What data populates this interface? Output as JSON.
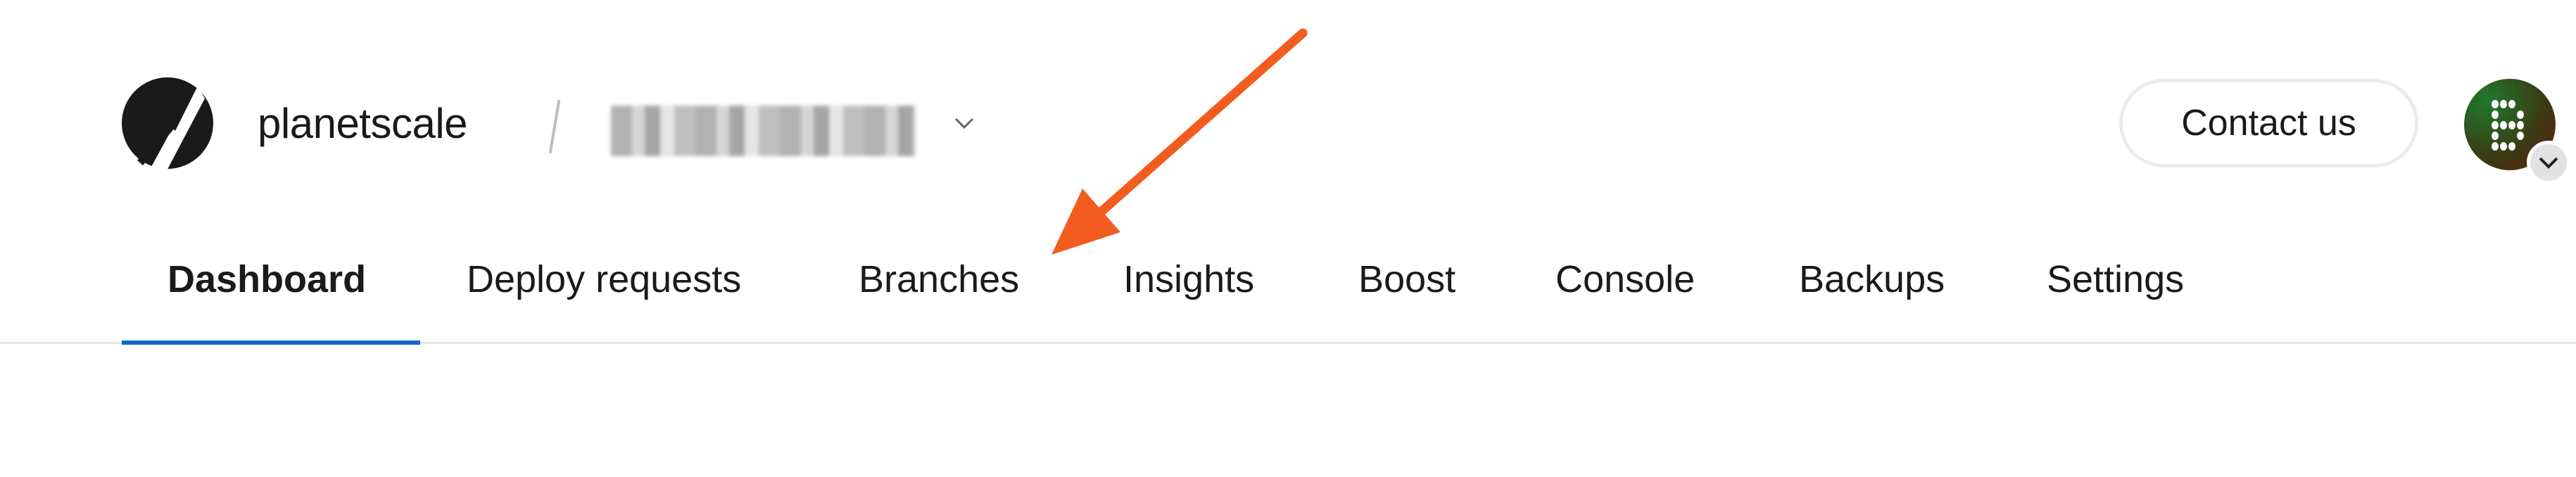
{
  "header": {
    "brand": "planetscale",
    "separator": "/",
    "database_name_redacted": true,
    "contact_label": "Contact us",
    "avatar_icon": "pixel-avatar-icon",
    "avatar_menu_icon": "chevron-down-icon"
  },
  "nav": {
    "tabs": [
      {
        "label": "Dashboard",
        "active": true
      },
      {
        "label": "Deploy requests"
      },
      {
        "label": "Branches"
      },
      {
        "label": "Insights"
      },
      {
        "label": "Boost"
      },
      {
        "label": "Console"
      },
      {
        "label": "Backups"
      },
      {
        "label": "Settings"
      }
    ]
  },
  "annotation": {
    "type": "arrow",
    "points_to": "Branches",
    "color": "#f25c1f"
  },
  "colors": {
    "accent": "#1566c4",
    "arrow": "#f25c1f",
    "text": "#1a1a1a"
  }
}
